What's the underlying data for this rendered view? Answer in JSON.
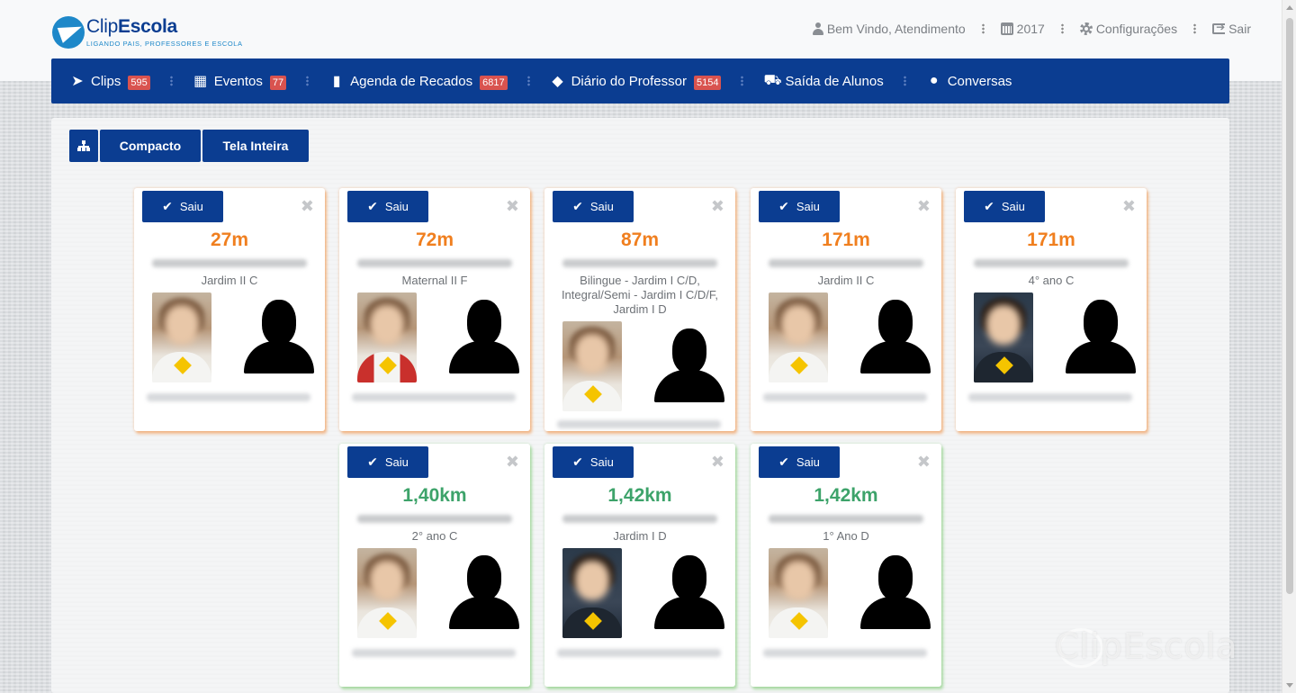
{
  "logo": {
    "name_light": "Clip",
    "name_bold": "Escola",
    "tagline": "LIGANDO PAIS, PROFESSORES E ESCOLA"
  },
  "user_nav": {
    "welcome": "Bem Vindo, Atendimento",
    "year": "2017",
    "settings": "Configurações",
    "logout": "Sair"
  },
  "main_nav": {
    "items": [
      {
        "label": "Clips",
        "badge": "595",
        "icon": "paper-plane-icon"
      },
      {
        "label": "Eventos",
        "badge": "77",
        "icon": "calendar-icon"
      },
      {
        "label": "Agenda de Recados",
        "badge": "6817",
        "icon": "book-icon"
      },
      {
        "label": "Diário do Professor",
        "badge": "5154",
        "icon": "graduation-cap-icon"
      },
      {
        "label": "Saída de Alunos",
        "badge": "",
        "icon": "car-icon"
      },
      {
        "label": "Conversas",
        "badge": "",
        "icon": "chat-icon"
      }
    ]
  },
  "toolbar": {
    "compact_label": "Compacto",
    "fullscreen_label": "Tela Inteira"
  },
  "card_common": {
    "saiu_label": "Saiu",
    "check_glyph": "✔",
    "close_glyph": "✖"
  },
  "cards": [
    {
      "distance": "27m",
      "class": "Jardim II C",
      "status": "orange"
    },
    {
      "distance": "72m",
      "class": "Maternal II F",
      "status": "orange"
    },
    {
      "distance": "87m",
      "class": "Bilingue - Jardim I C/D, Integral/Semi - Jardim I C/D/F, Jardim I D",
      "status": "orange"
    },
    {
      "distance": "171m",
      "class": "Jardim II C",
      "status": "orange"
    },
    {
      "distance": "171m",
      "class": "4° ano C",
      "status": "orange"
    },
    {
      "distance": "1,40km",
      "class": "2° ano C",
      "status": "green"
    },
    {
      "distance": "1,42km",
      "class": "Jardim I D",
      "status": "green"
    },
    {
      "distance": "1,42km",
      "class": "1° Ano D",
      "status": "green"
    }
  ],
  "watermark": "ClipEscola",
  "colors": {
    "primary": "#0b3d91",
    "orange": "#f07f1f",
    "green": "#3da36a",
    "badge": "#d9534f"
  }
}
